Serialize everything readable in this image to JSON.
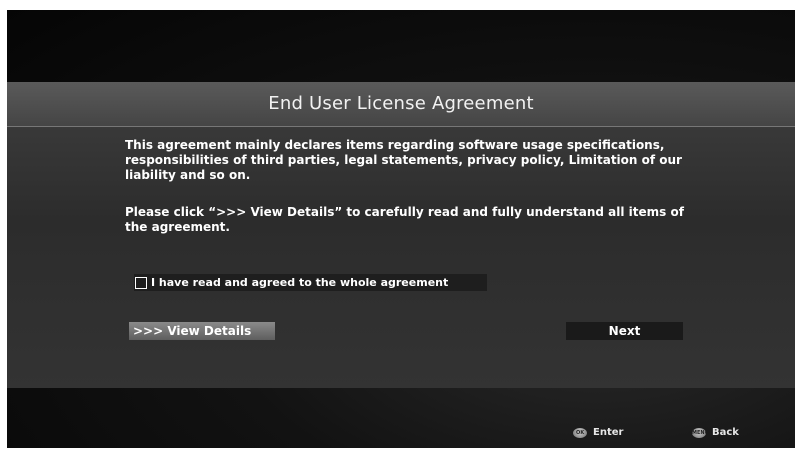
{
  "dialog": {
    "title": "End User License Agreement",
    "paragraph1": "This agreement mainly declares items regarding software usage specifications, responsibilities of third parties, legal statements, privacy policy, Limitation of our liability and so on.",
    "paragraph2": "Please click “>>> View Details” to carefully read and fully understand all items of the agreement.",
    "agree_checkbox": {
      "label": "I have read and agreed to the whole agreement",
      "checked": false
    },
    "view_details_label": ">>> View Details",
    "next_label": "Next"
  },
  "footer": {
    "enter": {
      "icon": "ok-icon",
      "icon_text": "OK",
      "label": "Enter"
    },
    "back": {
      "icon": "menu-icon",
      "icon_text": "MENU",
      "label": "Back"
    }
  }
}
